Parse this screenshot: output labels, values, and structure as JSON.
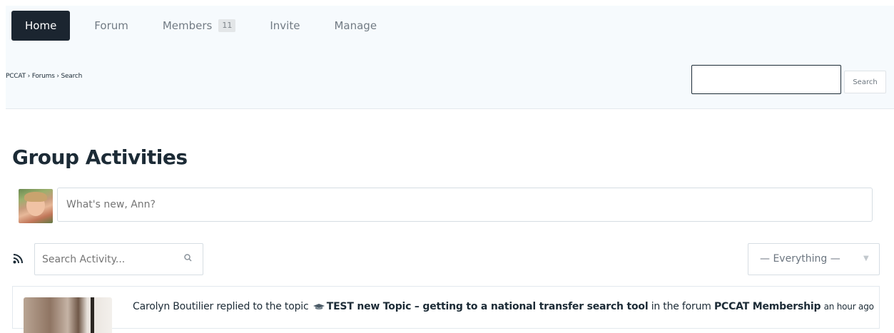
{
  "nav": {
    "tabs": [
      {
        "label": "Home",
        "active": true
      },
      {
        "label": "Forum"
      },
      {
        "label": "Members",
        "count": "11"
      },
      {
        "label": "Invite"
      },
      {
        "label": "Manage"
      }
    ]
  },
  "breadcrumb": [
    "PCCAT",
    "Forums",
    "Search"
  ],
  "breadcrumb_separator": " › ",
  "search": {
    "value": "",
    "button_label": "Search"
  },
  "page_title": "Group Activities",
  "post_form": {
    "placeholder": "What's new, Ann?",
    "avatar_icon": "user-avatar"
  },
  "activity_filter": {
    "rss_icon": "rss-icon",
    "search_placeholder": "Search Activity...",
    "search_icon": "magnifier-icon",
    "select_value": "— Everything —",
    "chevron_icon": "triangle-down-icon"
  },
  "activity": [
    {
      "user": "Carolyn Boutilier",
      "action": "replied to the topic",
      "topic": "TEST new Topic – getting to a national transfer search tool",
      "in_text": "in the forum",
      "forum": "PCCAT Membership",
      "time": "an hour ago"
    }
  ],
  "colors": {
    "accent_dark": "#1b2530",
    "topbar_bg": "#f6fafd",
    "text": "#1c2b36",
    "muted": "#727b84",
    "border": "#d6dde3"
  }
}
